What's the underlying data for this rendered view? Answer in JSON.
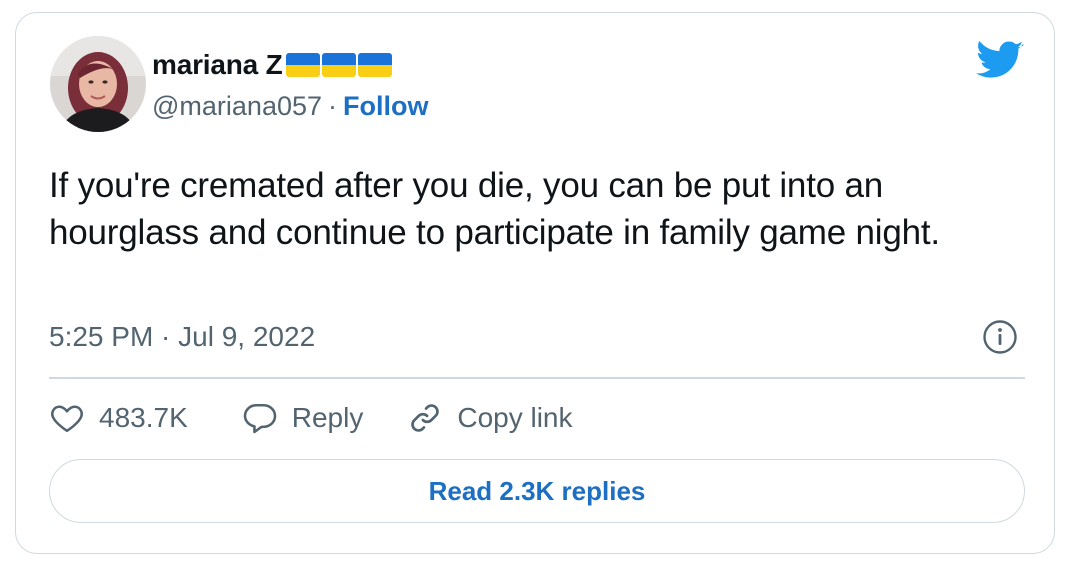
{
  "author": {
    "name": "mariana Z",
    "flags": [
      "ukraine-flag",
      "ukraine-flag",
      "ukraine-flag"
    ],
    "handle": "@mariana057",
    "separator": "·",
    "follow_label": "Follow"
  },
  "tweet": {
    "text": "If you're cremated after you die, you can be put into an hourglass and continue to participate in family game night.",
    "timestamp": "5:25 PM · Jul 9, 2022"
  },
  "actions": {
    "likes": "483.7K",
    "reply_label": "Reply",
    "copy_link_label": "Copy link"
  },
  "read_replies_label": "Read 2.3K replies",
  "colors": {
    "accent": "#1d6fc4",
    "twitter_blue": "#1d9bf0",
    "muted_text": "#536471",
    "border": "#cfd9de",
    "flag_blue": "#1a73d9",
    "flag_yellow": "#f9cf16"
  },
  "icons": {
    "brand": "twitter-bird-icon",
    "info": "info-icon",
    "like": "heart-icon",
    "reply": "reply-bubble-icon",
    "copy_link": "link-icon"
  }
}
